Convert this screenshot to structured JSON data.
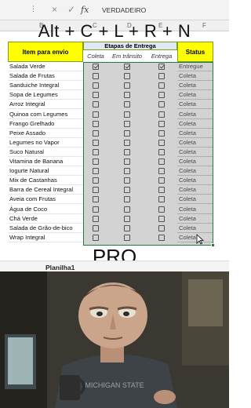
{
  "formula_bar": {
    "name_box": "",
    "cancel_icon": "×",
    "confirm_icon": "✓",
    "fx_label": "fx",
    "value": "VERDADEIRO"
  },
  "columns": [
    "B",
    "C",
    "D",
    "E",
    "F"
  ],
  "overlay": {
    "shortcut": "Alt + C + L + R + N",
    "pro": "PRO"
  },
  "table": {
    "header_item": "Item para envio",
    "header_group": "Etapas de Entrega",
    "sub_headers": [
      "Coleta",
      "Em trânsito",
      "Entrega"
    ],
    "header_status": "Status",
    "rows": [
      {
        "item": "Salada Verde",
        "checks": [
          true,
          true,
          true
        ],
        "status": "Entregue"
      },
      {
        "item": "Salada de Frutas",
        "checks": [
          false,
          false,
          false
        ],
        "status": "Coleta"
      },
      {
        "item": "Sanduiche Integral",
        "checks": [
          false,
          false,
          false
        ],
        "status": "Coleta"
      },
      {
        "item": "Sopa de Legumes",
        "checks": [
          false,
          false,
          false
        ],
        "status": "Coleta"
      },
      {
        "item": "Arroz Integral",
        "checks": [
          false,
          false,
          false
        ],
        "status": "Coleta"
      },
      {
        "item": "Quinoa com Legumes",
        "checks": [
          false,
          false,
          false
        ],
        "status": "Coleta"
      },
      {
        "item": "Frango Grelhado",
        "checks": [
          false,
          false,
          false
        ],
        "status": "Coleta"
      },
      {
        "item": "Peixe Assado",
        "checks": [
          false,
          false,
          false
        ],
        "status": "Coleta"
      },
      {
        "item": "Legumes no Vapor",
        "checks": [
          false,
          false,
          false
        ],
        "status": "Coleta"
      },
      {
        "item": "Suco Natural",
        "checks": [
          false,
          false,
          false
        ],
        "status": "Coleta"
      },
      {
        "item": "Vitamina de Banana",
        "checks": [
          false,
          false,
          false
        ],
        "status": "Coleta"
      },
      {
        "item": "Iogurte Natural",
        "checks": [
          false,
          false,
          false
        ],
        "status": "Coleta"
      },
      {
        "item": "Mix de Castanhas",
        "checks": [
          false,
          false,
          false
        ],
        "status": "Coleta"
      },
      {
        "item": "Barra de Cereal Integral",
        "checks": [
          false,
          false,
          false
        ],
        "status": "Coleta"
      },
      {
        "item": "Aveia com Frutas",
        "checks": [
          false,
          false,
          false
        ],
        "status": "Coleta"
      },
      {
        "item": "Água de Coco",
        "checks": [
          false,
          false,
          false
        ],
        "status": "Coleta"
      },
      {
        "item": "Chá Verde",
        "checks": [
          false,
          false,
          false
        ],
        "status": "Coleta"
      },
      {
        "item": "Salada de Grão-de-bico",
        "checks": [
          false,
          false,
          false
        ],
        "status": "Coleta"
      },
      {
        "item": "Wrap Integral",
        "checks": [
          false,
          false,
          false
        ],
        "status": "Coleta"
      }
    ]
  },
  "sheet_tabs": [
    "Planilha1"
  ],
  "colors": {
    "header_yellow": "#ffff00",
    "group_blue": "#dfe9f5",
    "selection_green": "#1e7b3c"
  }
}
